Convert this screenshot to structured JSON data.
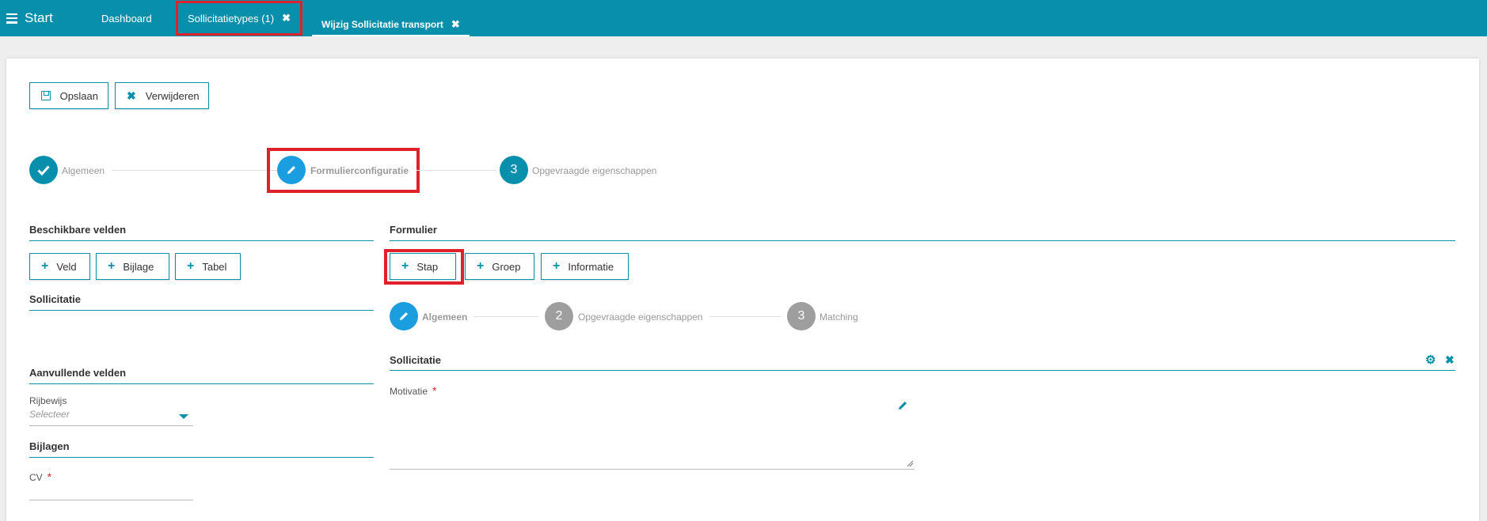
{
  "topbar": {
    "menu_label": "Start",
    "tabs": [
      {
        "label": "Dashboard"
      },
      {
        "label": "Sollicitatietypes (1)"
      },
      {
        "label": "Wijzig Sollicitatie transport"
      }
    ]
  },
  "toolbar": {
    "save_label": "Opslaan",
    "delete_label": "Verwijderen"
  },
  "wizard": {
    "steps": [
      {
        "label": "Algemeen",
        "state": "done"
      },
      {
        "label": "Formulierconfiguratie",
        "state": "active"
      },
      {
        "label": "Opgevraagde eigenschappen",
        "number": "3",
        "state": "todo"
      }
    ]
  },
  "left": {
    "available_fields_title": "Beschikbare velden",
    "buttons": [
      "Veld",
      "Bijlage",
      "Tabel"
    ],
    "sollicitatie_title": "Sollicitatie",
    "extra_fields_title": "Aanvullende velden",
    "rijbewijs_label": "Rijbewijs",
    "rijbewijs_placeholder": "Selecteer",
    "attachments_title": "Bijlagen",
    "cv_label": "CV",
    "required_mark": "*"
  },
  "form": {
    "title": "Formulier",
    "buttons": [
      "Stap",
      "Groep",
      "Informatie"
    ],
    "steps": [
      {
        "label": "Algemeen",
        "state": "active"
      },
      {
        "label": "Opgevraagde eigenschappen",
        "number": "2"
      },
      {
        "label": "Matching",
        "number": "3"
      }
    ],
    "group_title": "Sollicitatie",
    "motivatie_label": "Motivatie",
    "required_mark": "*"
  },
  "colors": {
    "primary": "#078fac",
    "active_step": "#1a9ee0",
    "inactive_step": "#9e9e9e",
    "highlight": "#e0202a"
  }
}
